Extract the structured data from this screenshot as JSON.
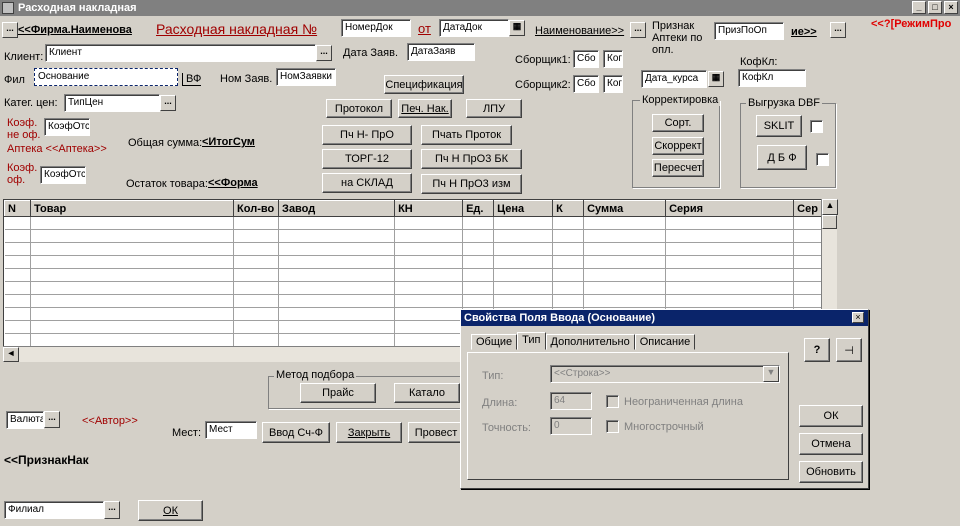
{
  "window": {
    "title": "Расходная накладная",
    "min": "_",
    "max": "□",
    "close": "×"
  },
  "header": {
    "firm_name": "<<Фирма.Наименова",
    "doc_title": "Расходная накладная №",
    "doc_number": "НомерДок",
    "from_label": "от",
    "doc_date": "ДатаДок",
    "name_link": "Наименование>>",
    "pharmacy_sign_label": "Признак Аптеки по опл.",
    "pharmacy_sign_value": "ПризПоОп",
    "ne_link": "ие>>",
    "mode_link": "<<?[РежимПро"
  },
  "form": {
    "client_label": "Клиент:",
    "client_value": "Клиент",
    "filial_label": "Фил",
    "basis_value": "Основание",
    "bf_label": "ВФ",
    "price_cat_label": "Катег. цен:",
    "price_cat_value": "ТипЦен",
    "coef_nof_label": "Коэф. не оф.",
    "coef_nof_value": "КоэфОтс",
    "pharmacy_link": "Аптека <<Аптека>>",
    "coef_of_label": "Коэф. оф.",
    "coef_of_value": "КоэфОтс",
    "date_req_label": "Дата Заяв.",
    "date_req_value": "ДатаЗаяв",
    "num_req_label": "Ном Заяв.",
    "num_req_value": "НомЗаявки",
    "picker1_label": "Сборщик1:",
    "picker1_a": "Сбо",
    "picker1_b": "Ког",
    "picker2_label": "Сборщик2:",
    "picker2_a": "Сбо",
    "picker2_b": "Ког",
    "rate_date": "Дата_курса",
    "kofkl_label": "КофКл:",
    "kofkl_value": "КофКл",
    "total_label": "Общая сумма:",
    "total_value": "<ИтогСум",
    "stock_label": "Остаток товара:",
    "stock_value": "<<Форма",
    "currency_value": "Валюта",
    "author_link": "<<Автор>>",
    "places_label": "Мест:",
    "places_value": "Мест",
    "sign_label": "<<ПризнакНак",
    "branch_value": "Филиал"
  },
  "buttons": {
    "spec": "Спецификация",
    "protocol": "Протокол",
    "print_inv": "Печ. Нак.",
    "lpu": "ЛПУ",
    "pch_npro": "Пч Н- ПрО",
    "print_proto": "Пчать Проток",
    "torg12": "ТОРГ-12",
    "pch_npro3bk": "Пч Н ПрО3 БК",
    "to_warehouse": "на СКЛАД",
    "pch_npro3izm": "Пч Н ПрО3 изм",
    "price": "Прайс",
    "catalog": "Катало",
    "enter_invoice": "Ввод Сч-Ф",
    "close": "Закрыть",
    "post": "Провест",
    "ok": "ОК"
  },
  "correction": {
    "title": "Корректировка",
    "sort": "Сорт.",
    "adjust": "Скоррект",
    "recalc": "Пересчет"
  },
  "dbf": {
    "title": "Выгрузка DBF",
    "sklit": "SKLIT",
    "dbf": "Д Б Ф"
  },
  "selection": {
    "title": "Метод подбора"
  },
  "table": {
    "columns": [
      "N",
      "Товар",
      "Кол-во",
      "Завод",
      "КН",
      "Ед.",
      "Цена",
      "К",
      "Сумма",
      "Серия",
      "Сер"
    ],
    "row_count": 10
  },
  "dialog": {
    "title": "Свойства  Поля Ввода (Основание)",
    "tabs": [
      "Общие",
      "Тип",
      "Дополнительно",
      "Описание"
    ],
    "active_tab": "Тип",
    "type_label": "Тип:",
    "type_value": "<<Строка>>",
    "length_label": "Длина:",
    "length_value": "64",
    "unlimited_label": "Неограниченная длина",
    "precision_label": "Точность:",
    "precision_value": "0",
    "multiline_label": "Многострочный",
    "ok": "ОК",
    "cancel": "Отмена",
    "refresh": "Обновить",
    "help_icon": "?",
    "pin_icon": "pin"
  }
}
